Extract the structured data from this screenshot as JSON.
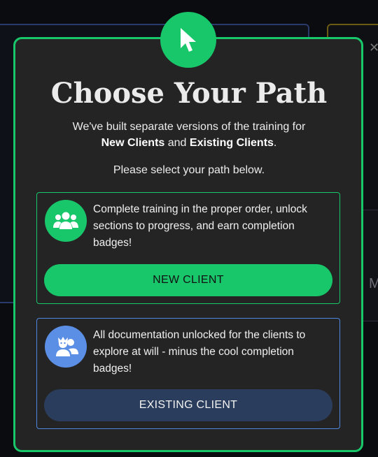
{
  "modal": {
    "title": "Choose Your Path",
    "intro_line1": "We've built separate versions of the training for",
    "intro_new": "New Clients",
    "intro_and": " and ",
    "intro_existing": "Existing Clients",
    "intro_period": ".",
    "select_prompt": "Please select your path below.",
    "icon": "cursor-arrow-icon"
  },
  "options": {
    "new_client": {
      "icon": "users-group-icon",
      "description": "Complete training in the proper order, unlock sections to progress, and earn completion badges!",
      "button_label": "NEW CLIENT"
    },
    "existing_client": {
      "icon": "masks-icon",
      "description": "All documentation unlocked for the clients to explore at will - minus the cool completion badges!",
      "button_label": "EXISTING CLIENT"
    }
  },
  "colors": {
    "accent_green": "#19c76b",
    "accent_blue": "#5b8fe6",
    "modal_bg": "#242424",
    "existing_button_bg": "#2b3d5c"
  }
}
